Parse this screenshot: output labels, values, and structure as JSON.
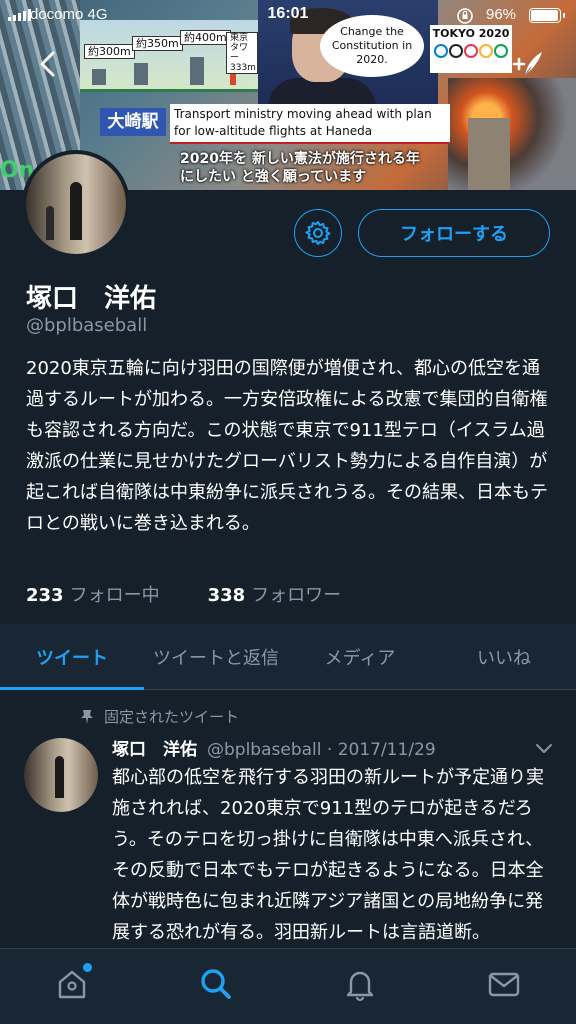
{
  "status_bar": {
    "carrier": "docomo 4G",
    "time": "16:01",
    "battery": "96%",
    "battery_level": 0.96
  },
  "banner": {
    "map_labels": [
      "約300m",
      "約350m",
      "約400m",
      "東京タワー 333m"
    ],
    "speech_bubble": "Change the Constitution in 2020.",
    "olympics": "TOKYO 2020",
    "station": "大崎駅",
    "headline": "Transport ministry moving ahead with plan for low-altitude flights at Haneda",
    "subtitle": "2020年を 新しい憲法が施行される年にしたい と強く願っています",
    "corner_text": "On"
  },
  "profile": {
    "follow_label": "フォローする",
    "name": "塚口　洋佑",
    "handle": "@bplbaseball",
    "bio": "2020東京五輪に向け羽田の国際便が増便され、都心の低空を通過するルートが加わる。一方安倍政権による改憲で集団的自衛権も容認される方向だ。この状態で東京で911型テロ（イスラム過激派の仕業に見せかけたグローバリスト勢力による自作自演）が起これば自衛隊は中東紛争に派兵されうる。その結果、日本もテロとの戦いに巻き込まれる。",
    "following_count": "233",
    "following_label": "フォロー中",
    "followers_count": "338",
    "followers_label": "フォロワー"
  },
  "tabs": [
    {
      "label": "ツイート",
      "active": true
    },
    {
      "label": "ツイートと返信",
      "active": false
    },
    {
      "label": "メディア",
      "active": false
    },
    {
      "label": "いいね",
      "active": false
    }
  ],
  "tweet": {
    "pinned_label": "固定されたツイート",
    "author": "塚口　洋佑",
    "handle_date": "@bplbaseball · 2017/11/29",
    "text": "都心部の低空を飛行する羽田の新ルートが予定通り実施されれば、2020東京で911型のテロが起きるだろう。そのテロを切っ掛けに自衛隊は中東へ派兵され、その反動で日本でもテロが起きるようになる。日本全体が戦時色に包まれ近隣アジア諸国との局地紛争に発展する恐れが有る。羽田新ルートは言語道断。"
  },
  "colors": {
    "background": "#15202b",
    "accent": "#1da1f2",
    "secondary_text": "#8899a6"
  },
  "icons": [
    "back-arrow-icon",
    "new-tweet-icon",
    "gear-icon",
    "pin-icon",
    "chevron-down-icon",
    "home-icon",
    "search-icon",
    "bell-icon",
    "mail-icon"
  ]
}
